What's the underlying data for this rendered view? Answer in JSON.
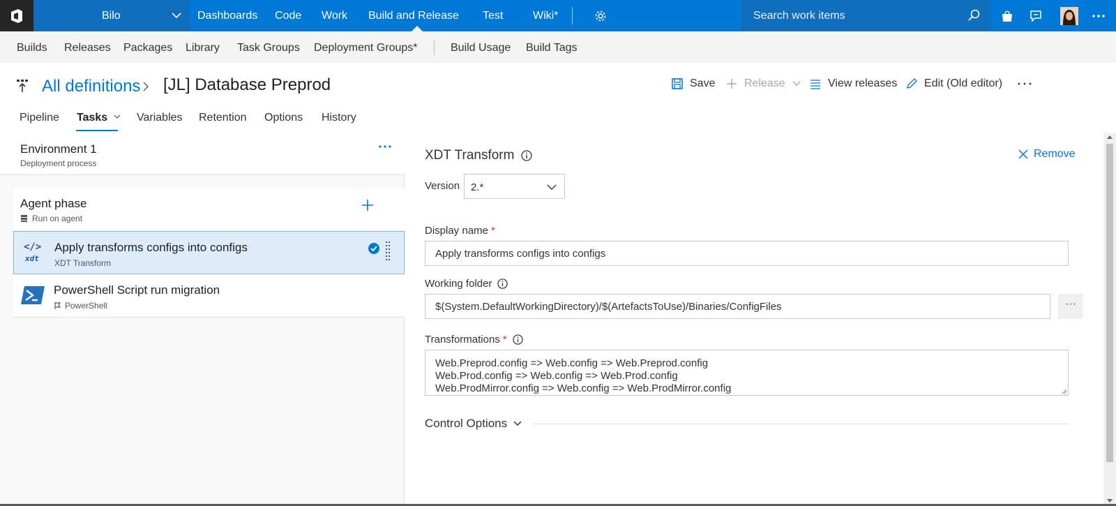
{
  "topbar": {
    "project": "Bilo",
    "nav": [
      "Dashboards",
      "Code",
      "Work",
      "Build and Release",
      "Test",
      "Wiki*"
    ],
    "active_nav": "Build and Release",
    "search_placeholder": "Search work items"
  },
  "subnav": {
    "items": [
      "Builds",
      "Releases",
      "Packages",
      "Library",
      "Task Groups",
      "Deployment Groups*",
      "Build Usage",
      "Build Tags"
    ]
  },
  "header": {
    "breadcrumb_link": "All definitions",
    "title": "[JL] Database Preprod",
    "actions": {
      "save": "Save",
      "release": "Release",
      "view_releases": "View releases",
      "edit_old": "Edit (Old editor)"
    }
  },
  "tabs": [
    "Pipeline",
    "Tasks",
    "Variables",
    "Retention",
    "Options",
    "History"
  ],
  "active_tab": "Tasks",
  "environment": {
    "title": "Environment 1",
    "subtitle": "Deployment process"
  },
  "phase": {
    "title": "Agent phase",
    "subtitle": "Run on agent"
  },
  "tasks": [
    {
      "name": "Apply transforms configs into configs",
      "type": "XDT Transform",
      "icon_label": "xdt",
      "icon_code": "</>",
      "selected": true
    },
    {
      "name": "PowerShell Script run migration",
      "type": "PowerShell",
      "selected": false
    }
  ],
  "detail": {
    "title": "XDT Transform",
    "remove": "Remove",
    "version_label": "Version",
    "version_value": "2.*",
    "display_name_label": "Display name",
    "display_name_value": "Apply transforms configs into configs",
    "working_folder_label": "Working folder",
    "working_folder_value": "$(System.DefaultWorkingDirectory)/$(ArtefactsToUse)/Binaries/ConfigFiles",
    "browse": "···",
    "transformations_label": "Transformations",
    "transformations_lines": [
      "Web.Preprod.config => Web.config => Web.Preprod.config",
      "Web.Prod.config => Web.config => Web.Prod.config",
      "Web.ProdMirror.config => Web.config => Web.ProdMirror.config"
    ],
    "required_mark": "*",
    "control_options": "Control Options"
  },
  "colors": {
    "accent": "#0078d7",
    "topbar": "#0078d7",
    "selected_row": "#deecf9",
    "required": "#d13438"
  },
  "icons": {
    "logo": "azure-devops-logo-icon",
    "settings": "gear-icon",
    "search": "search-icon",
    "marketplace": "shopping-bag-icon",
    "feedback": "feedback-icon",
    "more": "more-icon"
  }
}
